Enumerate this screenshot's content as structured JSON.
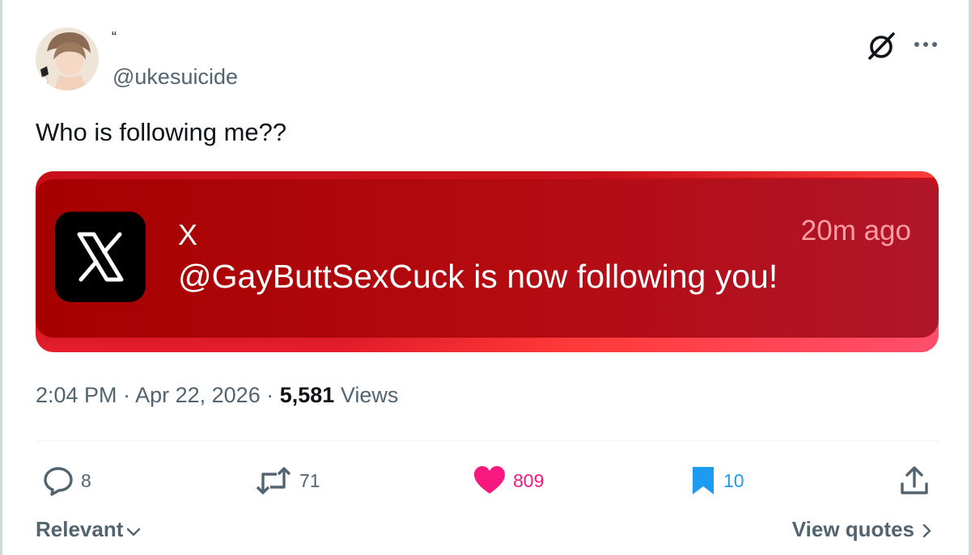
{
  "author": {
    "display_name": "“",
    "handle": "@ukesuicide",
    "avatar_icon": "avatar-illustration"
  },
  "tweet": {
    "text": "Who is following me??"
  },
  "notification": {
    "app_name": "X",
    "time": "20m ago",
    "message": "@GayButtSexCuck is now following you!",
    "app_icon": "x-logo-icon",
    "accent_color": "#b40b11"
  },
  "meta": {
    "time": "2:04 PM",
    "separator": "·",
    "date": "Apr 22, 2026",
    "views_count": "5,581",
    "views_label": "Views"
  },
  "actions": {
    "reply_count": "8",
    "retweet_count": "71",
    "like_count": "809",
    "bookmark_count": "10",
    "like_color": "#f91880",
    "bookmark_color": "#1d9bf0"
  },
  "footer": {
    "sort_label": "Relevant",
    "view_quotes_label": "View quotes"
  }
}
